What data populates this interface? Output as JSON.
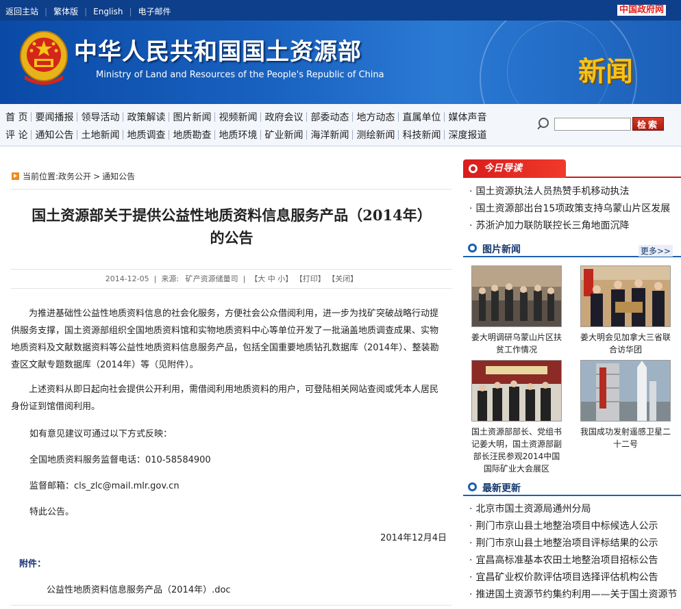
{
  "topbar": {
    "links": [
      "返回主站",
      "繁体版",
      "English",
      "电子邮件"
    ],
    "gov_logo": "中国政府网"
  },
  "banner": {
    "title": "中华人民共和国国土资源部",
    "subtitle": "Ministry of Land and Resources of the People's Republic of China",
    "news_mark": "新闻"
  },
  "nav": {
    "row1": [
      "首 页",
      "要闻播报",
      "领导活动",
      "政策解读",
      "图片新闻",
      "视频新闻",
      "政府会议",
      "部委动态",
      "地方动态",
      "直属单位",
      "媒体声音"
    ],
    "row2": [
      "评 论",
      "通知公告",
      "土地新闻",
      "地质调查",
      "地质勘查",
      "地质环境",
      "矿业新闻",
      "海洋新闻",
      "测绘新闻",
      "科技新闻",
      "深度报道"
    ],
    "search_value": "",
    "search_button": "检索"
  },
  "breadcrumb": {
    "label": "当前位置:",
    "items": [
      "政务公开",
      "通知公告"
    ],
    "sep": ">"
  },
  "article": {
    "title_line1": "国土资源部关于提供公益性地质资料信息服务产品（2014年）",
    "title_line2": "的公告",
    "date": "2014-12-05",
    "source_label": "来源:",
    "source": "矿产资源储量司",
    "font_tools": "【大 中 小】",
    "print": "【打印】",
    "close": "【关闭】",
    "p1": "为推进基础性公益性地质资料信息的社会化服务，方便社会公众借阅利用，进一步为找矿突破战略行动提供服务支撑，国土资源部组织全国地质资料馆和实物地质资料中心等单位开发了一批涵盖地质调查成果、实物地质资料及文献数据资料等公益性地质资料信息服务产品，包括全国重要地质钻孔数据库（2014年）、整装勘查区文献专题数据库（2014年）等（见附件）。",
    "p2": "上述资料从即日起向社会提供公开利用，需借阅利用地质资料的用户，可登陆相关网站查阅或凭本人居民身份证到馆借阅利用。",
    "p3": "如有意见建议可通过以下方式反映：",
    "p4": "全国地质资料服务监督电话：010-58584900",
    "p5": "监督邮箱：cls_zlc@mail.mlr.gov.cn",
    "p6": "特此公告。",
    "sign_date": "2014年12月4日",
    "attach_label": "附件：",
    "attach_file": "公益性地质资料信息服务产品（2014年）.doc"
  },
  "right": {
    "today_title": "今日导读",
    "today_items": [
      "国土资源执法人员热赞手机移动执法",
      "国土资源部出台15项政策支持乌蒙山片区发展",
      "苏浙沪加力联防联控长三角地面沉降"
    ],
    "photo_title": "图片新闻",
    "more": "更多>>",
    "photos": [
      {
        "caption": "姜大明调研乌蒙山片区扶贫工作情况"
      },
      {
        "caption": "姜大明会见加拿大三省联合访华团"
      },
      {
        "caption": "国土资源部部长、党组书记姜大明，国土资源部副部长汪民参观2014中国国际矿业大会展区"
      },
      {
        "caption": "我国成功发射遥感卫星二十二号"
      }
    ],
    "latest_title": "最新更新",
    "latest_items": [
      "北京市国土资源局通州分局",
      "荆门市京山县土地整治项目中标候选人公示",
      "荆门市京山县土地整治项目评标结果的公示",
      "宜昌高标准基本农田土地整治项目招标公告",
      "宜昌矿业权价款评估项目选择评估机构公告",
      "推进国土资源节约集约利用——关于国土资源节"
    ]
  },
  "colors": {
    "topbar": "#0d3f8a",
    "banner": "#1a62c0",
    "accent_red": "#d81c1c",
    "section_blue": "#1b5fb0"
  }
}
